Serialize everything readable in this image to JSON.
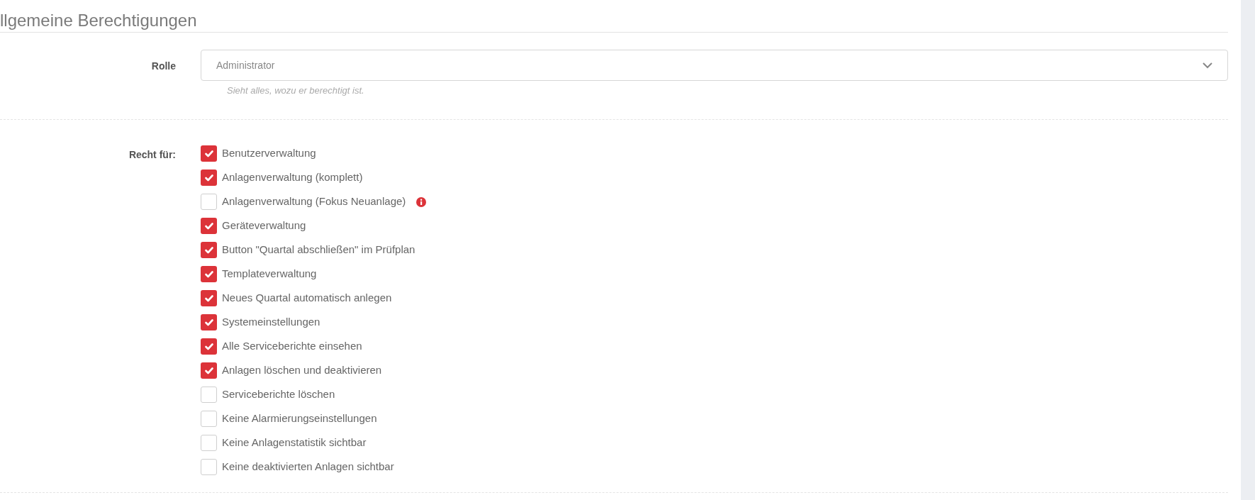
{
  "section_title": "llgemeine Berechtigungen",
  "role": {
    "label": "Rolle",
    "value": "Administrator",
    "hint": "Sieht alles, wozu er berechtigt ist."
  },
  "rights": {
    "label": "Recht für:",
    "items": [
      {
        "label": "Benutzerverwaltung",
        "checked": true
      },
      {
        "label": "Anlagenverwaltung (komplett)",
        "checked": true
      },
      {
        "label": "Anlagenverwaltung (Fokus Neuanlage)",
        "checked": false,
        "info": true
      },
      {
        "label": "Geräteverwaltung",
        "checked": true
      },
      {
        "label": "Button \"Quartal abschließen\" im Prüfplan",
        "checked": true
      },
      {
        "label": "Templateverwaltung",
        "checked": true
      },
      {
        "label": "Neues Quartal automatisch anlegen",
        "checked": true
      },
      {
        "label": "Systemeinstellungen",
        "checked": true
      },
      {
        "label": "Alle Serviceberichte einsehen",
        "checked": true
      },
      {
        "label": "Anlagen löschen und deaktivieren",
        "checked": true
      },
      {
        "label": "Serviceberichte löschen",
        "checked": false
      },
      {
        "label": "Keine Alarmierungseinstellungen",
        "checked": false
      },
      {
        "label": "Keine Anlagenstatistik sichtbar",
        "checked": false
      },
      {
        "label": "Keine deaktivierten Anlagen sichtbar",
        "checked": false
      }
    ]
  }
}
